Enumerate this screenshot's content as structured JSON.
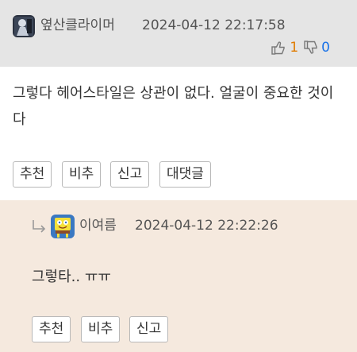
{
  "comment": {
    "author": "옆산클라이머",
    "timestamp": "2024-04-12 22:17:58",
    "upvotes": "1",
    "downvotes": "0",
    "body": "그렇다 헤어스타일은 상관이 없다. 얼굴이 중요한 것이다",
    "actions": {
      "recommend": "추천",
      "not_recommend": "비추",
      "report": "신고",
      "reply": "대댓글"
    }
  },
  "reply": {
    "author": "이여름",
    "timestamp": "2024-04-12 22:22:26",
    "body": "그렇타.. ㅠㅠ",
    "actions": {
      "recommend": "추천",
      "not_recommend": "비추",
      "report": "신고"
    }
  },
  "colors": {
    "header_bg": "#e5e5e5",
    "reply_bg": "#f5e9de",
    "upvote": "#e07b00",
    "downvote": "#1a73e8"
  }
}
